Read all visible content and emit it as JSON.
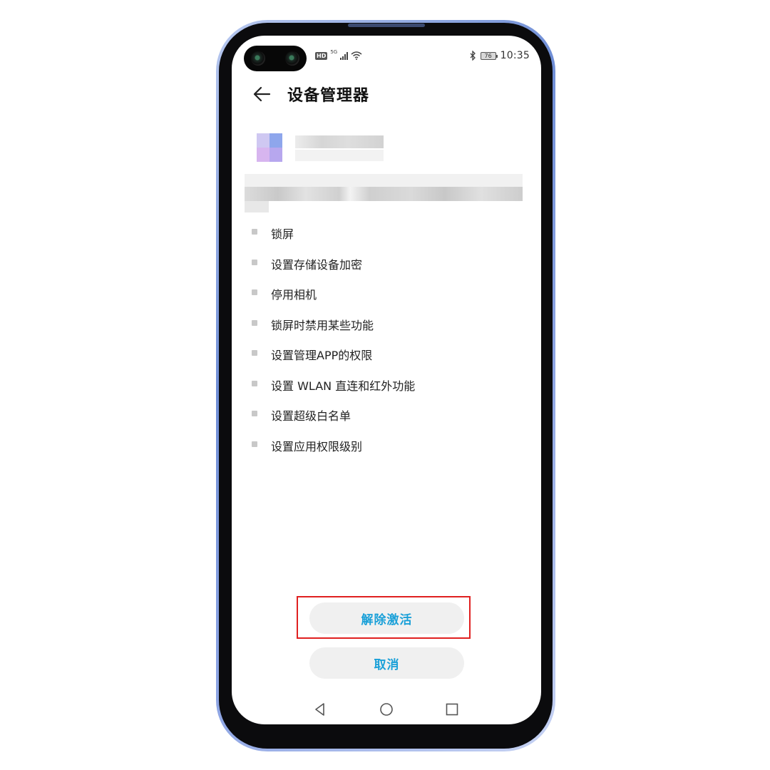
{
  "status_bar": {
    "hd": "HD",
    "network": "5G",
    "battery": "76",
    "time": "10:35"
  },
  "header": {
    "title": "设备管理器"
  },
  "permissions": [
    "锁屏",
    "设置存储设备加密",
    "停用相机",
    "锁屏时禁用某些功能",
    "设置管理APP的权限",
    "设置 WLAN 直连和红外功能",
    "设置超级白名单",
    "设置应用权限级别"
  ],
  "actions": {
    "deactivate": "解除激活",
    "cancel": "取消"
  },
  "colors": {
    "accent": "#1aa0d8",
    "highlight": "#e02020"
  }
}
